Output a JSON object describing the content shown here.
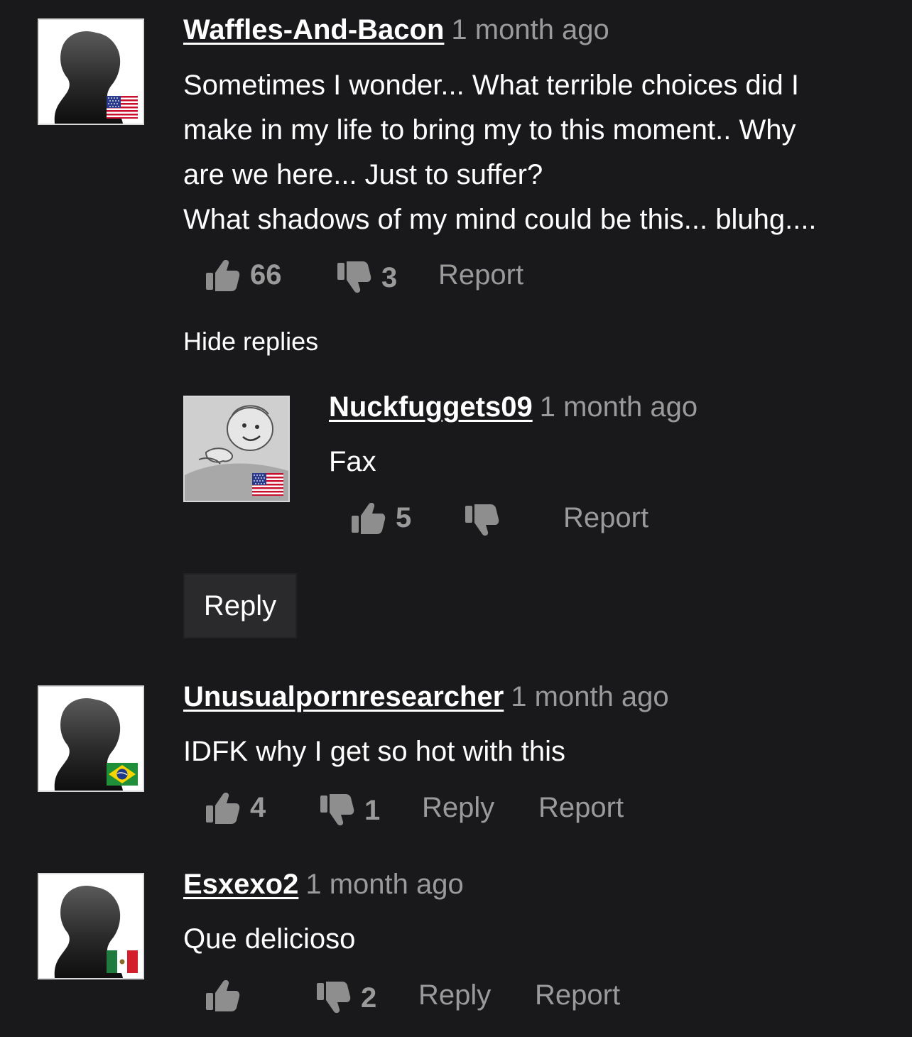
{
  "comments": [
    {
      "username": "Waffles-And-Bacon",
      "timestamp": "1 month ago",
      "text_lines": [
        "Sometimes I wonder... What terrible choices did I",
        "make in my life to bring my to this moment.. Why",
        "are we here... Just to suffer?",
        "What shadows of my mind could be this... bluhg...."
      ],
      "likes": "66",
      "dislikes": "3",
      "report_label": "Report",
      "flag": "us-flag",
      "hide_replies_label": "Hide replies",
      "replies": [
        {
          "username": "Nuckfuggets09",
          "timestamp": "1 month ago",
          "text": "Fax",
          "likes": "5",
          "dislikes": "",
          "report_label": "Report",
          "flag": "us-flag"
        }
      ],
      "reply_button_label": "Reply"
    },
    {
      "username": "Unusualpornresearcher",
      "timestamp": "1 month ago",
      "text": "IDFK why I get so hot with this",
      "likes": "4",
      "dislikes": "1",
      "reply_label": "Reply",
      "report_label": "Report",
      "flag": "brazil-flag"
    },
    {
      "username": "Esxexo2",
      "timestamp": "1 month ago",
      "text": "Que delicioso",
      "likes": "",
      "dislikes": "2",
      "reply_label": "Reply",
      "report_label": "Report",
      "flag": "mexico-flag"
    }
  ],
  "colors": {
    "background": "#19181b",
    "muted_text": "#9a9a9a",
    "icon": "#8e8e8e",
    "button_bg": "#2a2a2c"
  }
}
